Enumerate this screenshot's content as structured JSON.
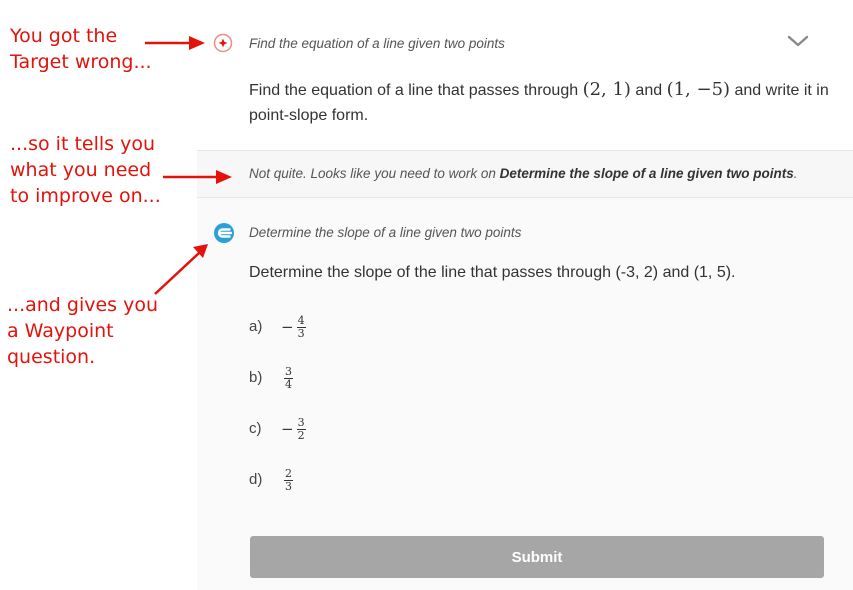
{
  "annotations": {
    "first": [
      "You got the",
      "Target wrong..."
    ],
    "second": [
      "...so it tells you",
      "what you need",
      "to improve on..."
    ],
    "third": [
      "...and gives you",
      "a Waypoint",
      "question."
    ]
  },
  "target": {
    "skill_title": "Find the equation of a line given two points",
    "question_prefix": "Find the equation of a line that passes through ",
    "point1": "(2, 1)",
    "connector": " and ",
    "point2": "(1, −5)",
    "question_suffix": " and write it in point-slope form."
  },
  "feedback": {
    "prefix": "Not quite. Looks like you need to work on ",
    "skill": "Determine the slope of a line given two points",
    "suffix": "."
  },
  "waypoint": {
    "skill_title": "Determine the slope of a line given two points",
    "question": "Determine the slope of the line that passes through (-3, 2) and (1, 5).",
    "options": [
      {
        "letter": "a)",
        "sign": "−",
        "num": "4",
        "den": "3"
      },
      {
        "letter": "b)",
        "sign": "",
        "num": "3",
        "den": "4"
      },
      {
        "letter": "c)",
        "sign": "−",
        "num": "3",
        "den": "2"
      },
      {
        "letter": "d)",
        "sign": "",
        "num": "2",
        "den": "3"
      }
    ],
    "submit_label": "Submit"
  },
  "colors": {
    "annotation_red": "#e3120b",
    "waypoint_blue": "#2a9fd8",
    "submit_gray": "#a6a6a6"
  },
  "icons": [
    "target-icon",
    "waypoint-icon",
    "chevron-down-icon"
  ]
}
